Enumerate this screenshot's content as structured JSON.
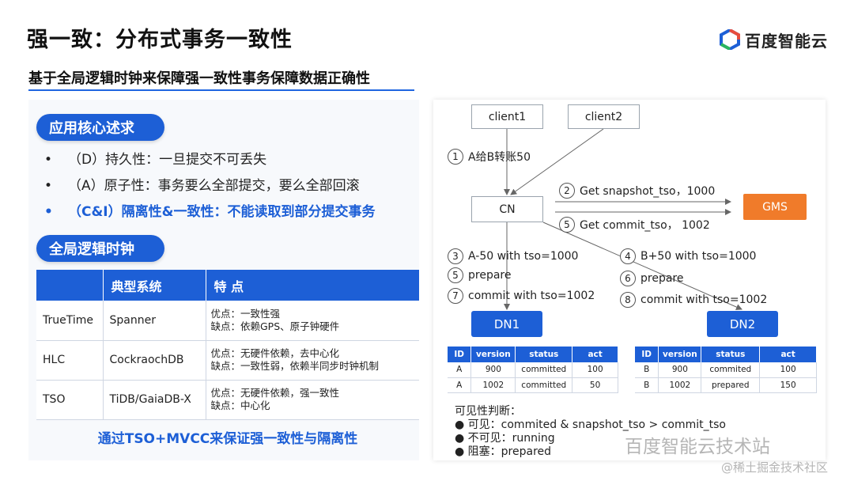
{
  "header": {
    "title": "强一致：分布式事务一致性",
    "logo_text": "百度智能云",
    "subtitle": "基于全局逻辑时钟来保障强一致性事务保障数据正确性"
  },
  "left": {
    "section1_label": "应用核心述求",
    "bullets": [
      {
        "dot": "•",
        "text": "（D）持久性：一旦提交不可丢失"
      },
      {
        "dot": "•",
        "text": "（A）原子性：事务要么全部提交，要么全部回滚"
      },
      {
        "dot": "•",
        "text": "（C&I）隔离性&一致性：不能读取到部分提交事务"
      }
    ],
    "section2_label": "全局逻辑时钟",
    "table": {
      "headers": [
        "",
        "典型系统",
        "特 点"
      ],
      "rows": [
        {
          "name": "TrueTime",
          "system": "Spanner",
          "pro": "优点：一致性强",
          "con": "缺点：依赖GPS、原子钟硬件"
        },
        {
          "name": "HLC",
          "system": "CockraochDB",
          "pro": "优点：无硬件依赖，去中心化",
          "con": "缺点：一致性弱，依赖半同步时钟机制"
        },
        {
          "name": "TSO",
          "system": "TiDB/GaiaDB-X",
          "pro": "优点：无硬件依赖，强一致性",
          "con": "缺点：中心化"
        }
      ]
    },
    "footnote": "通过TSO+MVCC来保证强一致性与隔离性"
  },
  "diagram": {
    "nodes": {
      "client1": "client1",
      "client2": "client2",
      "cn": "CN",
      "gms": "GMS",
      "dn1": "DN1",
      "dn2": "DN2"
    },
    "steps": {
      "s1": {
        "num": "1",
        "text": "A给B转账50"
      },
      "s2": {
        "num": "2",
        "text": "Get snapshot_tso，1000"
      },
      "s5a": {
        "num": "5",
        "text": "Get commit_tso， 1002"
      },
      "s3": {
        "num": "3",
        "text": "A-50 with tso=1000"
      },
      "s5b": {
        "num": "5",
        "text": "prepare"
      },
      "s7": {
        "num": "7",
        "text": "commit with tso=1002"
      },
      "s4": {
        "num": "4",
        "text": "B+50 with tso=1000"
      },
      "s6": {
        "num": "6",
        "text": "prepare"
      },
      "s8": {
        "num": "8",
        "text": "commit with tso=1002"
      }
    },
    "dn1_table": {
      "headers": [
        "ID",
        "version",
        "status",
        "act"
      ],
      "rows": [
        [
          "A",
          "900",
          "committed",
          "100"
        ],
        [
          "A",
          "1002",
          "committed",
          "50"
        ]
      ]
    },
    "dn2_table": {
      "headers": [
        "ID",
        "version",
        "status",
        "act"
      ],
      "rows": [
        [
          "B",
          "900",
          "commited",
          "100"
        ],
        [
          "B",
          "1002",
          "prepared",
          "150"
        ]
      ]
    },
    "visibility": {
      "title": "可见性判断：",
      "lines": [
        "● 可见：commited & snapshot_tso > commit_tso",
        "● 不可见：running",
        "● 阻塞：prepared"
      ]
    }
  },
  "watermarks": {
    "wm1": "百度智能云技术站",
    "wm2": "@稀土掘金技术社区"
  },
  "colors": {
    "accent": "#1d5fd6",
    "gms": "#f07b2a"
  }
}
